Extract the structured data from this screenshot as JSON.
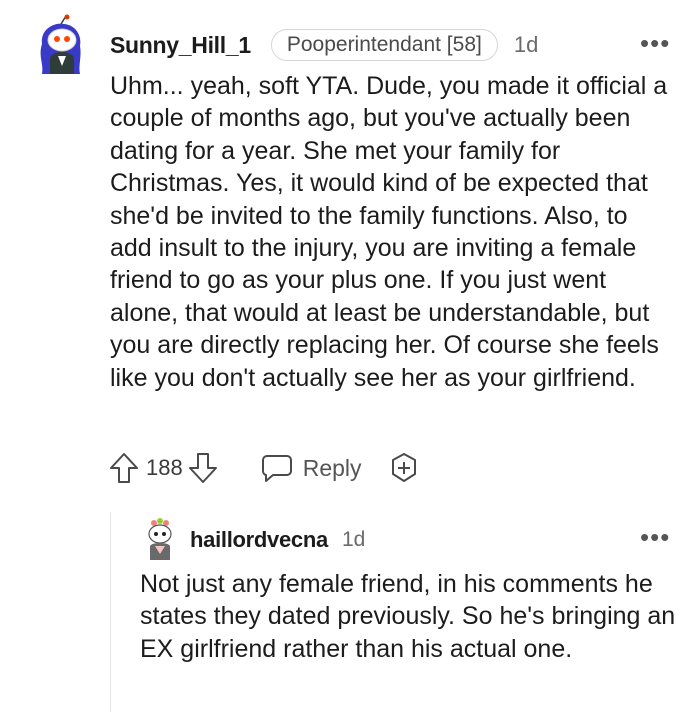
{
  "comments": [
    {
      "username": "Sunny_Hill_1",
      "flair": "Pooperintendant [58]",
      "age": "1d",
      "more_label": "•••",
      "body": "Uhm... yeah, soft YTA. Dude, you made it official a couple of months ago, but you've actually been dating for a year. She met your family for Christmas. Yes, it would kind of be expected that she'd be invited to the family functions. Also, to add insult to the injury, you are inviting a female friend to go as your plus one. If you just went alone, that would at least be understandable, but you are directly replacing her. Of course she feels like you don't actually see her as your girlfriend.",
      "score": "188",
      "reply_label": "Reply",
      "icons": [
        "upvote-icon",
        "downvote-icon",
        "reply-bubble-icon",
        "award-plus-icon"
      ]
    },
    {
      "username": "haillordvecna",
      "age": "1d",
      "more_label": "•••",
      "body": "Not just any female friend, in his comments he states they dated previously. So he's bringing an EX girlfriend rather than his actual one."
    }
  ],
  "colors": {
    "text": "#1c1c1c",
    "muted": "#6a6a6a",
    "avatar_blue": "#3a3ac8",
    "reddit_orange": "#ff4500",
    "thread_line": "#e5e5e5"
  }
}
